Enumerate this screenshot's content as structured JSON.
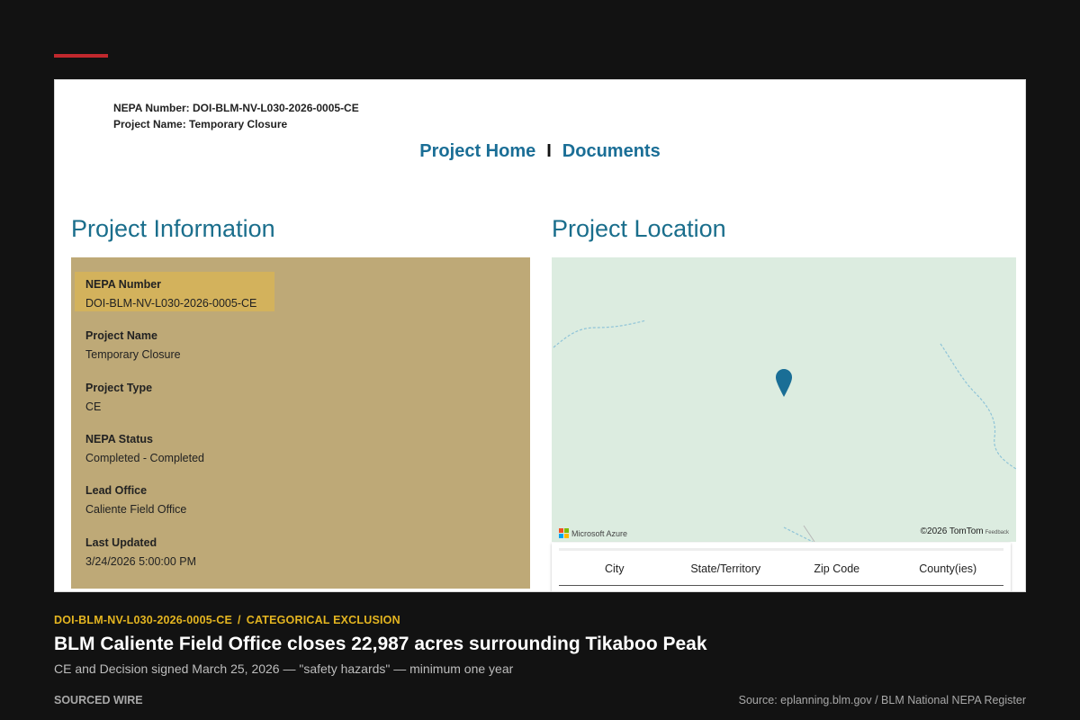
{
  "header_meta": {
    "nepa_line": "NEPA Number: DOI-BLM-NV-L030-2026-0005-CE",
    "project_line": "Project Name: Temporary Closure"
  },
  "nav": {
    "project_home": "Project Home",
    "separator": "I",
    "documents": "Documents"
  },
  "project_information": {
    "heading": "Project Information",
    "fields": [
      {
        "label": "NEPA Number",
        "value": "DOI-BLM-NV-L030-2026-0005-CE",
        "highlighted": true
      },
      {
        "label": "Project Name",
        "value": "Temporary Closure"
      },
      {
        "label": "Project Type",
        "value": "CE"
      },
      {
        "label": "NEPA Status",
        "value": "Completed - Completed"
      },
      {
        "label": "Lead Office",
        "value": "Caliente Field Office"
      },
      {
        "label": "Last Updated",
        "value": "3/24/2026 5:00:00 PM"
      }
    ]
  },
  "project_location": {
    "heading": "Project Location",
    "map": {
      "provider": "Microsoft Azure",
      "copyright": "©2026 TomTom",
      "feedback": "Feedback",
      "marker_icon": "map-pin-icon"
    },
    "table_columns": [
      "City",
      "State/Territory",
      "Zip Code",
      "County(ies)"
    ]
  },
  "caption": {
    "kicker_id": "DOI-BLM-NV-L030-2026-0005-CE",
    "kicker_sep": "/",
    "kicker_type": "CATEGORICAL EXCLUSION",
    "headline": "BLM Caliente Field Office closes 22,987 acres surrounding Tikaboo Peak",
    "subhead": "CE and Decision signed March 25, 2026 — \"safety hazards\" — minimum one year",
    "brand": "SOURCED WIRE",
    "source": "Source: eplanning.blm.gov / BLM National NEPA Register"
  },
  "colors": {
    "accent_red": "#c0282d",
    "kicker_gold": "#e4b520",
    "link_blue": "#1a6e96",
    "panel_tan": "#bea977",
    "highlight_gold": "#d3b25c",
    "map_green": "#dcece0",
    "marker_blue": "#1a6e96"
  }
}
